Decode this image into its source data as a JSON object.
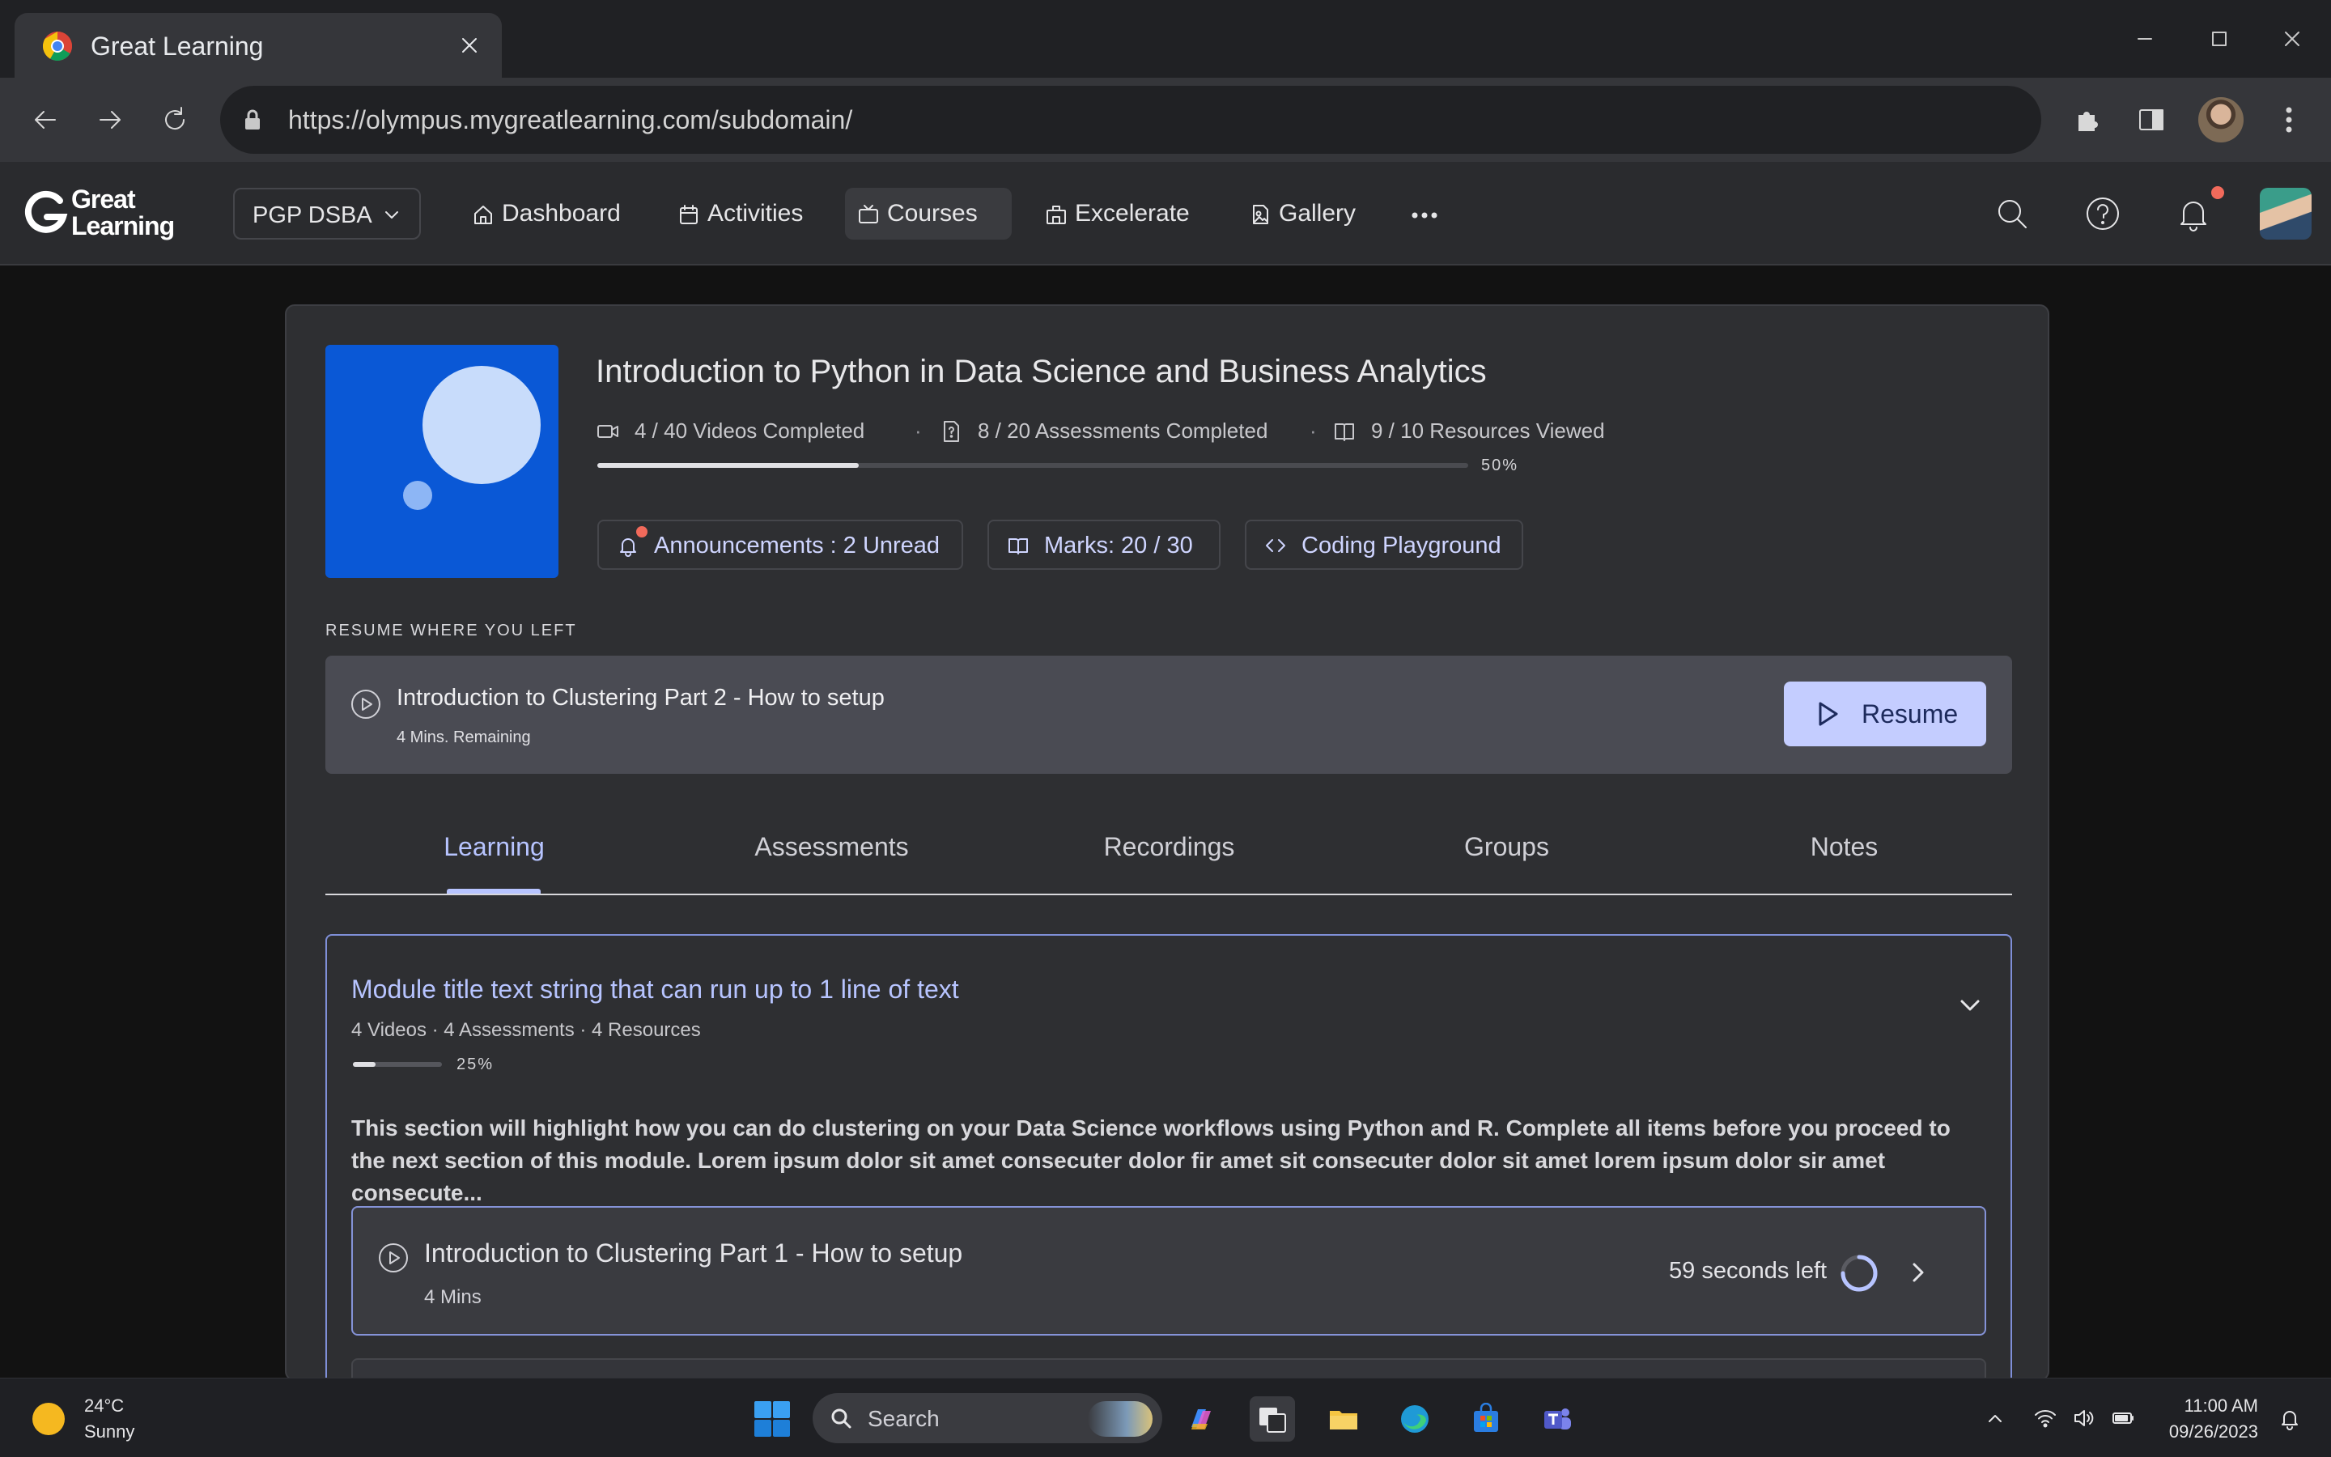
{
  "browser": {
    "tab_title": "Great Learning",
    "url": "https://olympus.mygreatlearning.com/subdomain/"
  },
  "header": {
    "logo_line1": "Great",
    "logo_line2": "Learning",
    "program": "PGP DSBA",
    "nav": [
      {
        "label": "Dashboard",
        "icon": "home-icon"
      },
      {
        "label": "Activities",
        "icon": "calendar-icon"
      },
      {
        "label": "Courses",
        "icon": "tv-icon",
        "active": true
      },
      {
        "label": "Excelerate",
        "icon": "building-icon"
      },
      {
        "label": "Gallery",
        "icon": "image-icon"
      }
    ]
  },
  "course": {
    "title": "Introduction to Python in Data Science and Business Analytics",
    "stats": {
      "videos": "4 / 40 Videos Completed",
      "assessments": "8 / 20 Assessments Completed",
      "resources": "9 / 10 Resources Viewed"
    },
    "progress_percent": 30,
    "progress_label": "50%",
    "chips": {
      "announcements": "Announcements : 2 Unread",
      "marks": "Marks: 20 / 30",
      "playground": "Coding Playground"
    }
  },
  "resume": {
    "section_label": "RESUME WHERE YOU LEFT",
    "title": "Introduction to Clustering Part 2 - How to setup",
    "remaining": "4 Mins. Remaining",
    "button": "Resume"
  },
  "tabs": [
    "Learning",
    "Assessments",
    "Recordings",
    "Groups",
    "Notes"
  ],
  "module": {
    "title": "Module title text string that can run up to 1 line of text",
    "meta": "4 Videos · 4 Assessments · 4 Resources",
    "progress_percent": 25,
    "progress_label": "25%",
    "description": "This section will highlight how you can do clustering on your Data Science workflows using Python and R. Complete all items before you proceed to the next section of this module. Lorem ipsum dolor sit amet consecuter dolor fir amet sit consecuter dolor sit amet lorem ipsum dolor sir amet consecute...",
    "item": {
      "title": "Introduction to Clustering Part 1 - How to setup",
      "duration": "4 Mins",
      "time_left": "59 seconds left"
    }
  },
  "taskbar": {
    "temperature": "24°C",
    "condition": "Sunny",
    "search_placeholder": "Search",
    "time": "11:00 AM",
    "date": "09/26/2023"
  },
  "colors": {
    "accent": "#b7c4ff",
    "resume_button": "#c4cdff",
    "thumbnail": "#0a58d6",
    "notification_dot": "#f26a5b"
  }
}
